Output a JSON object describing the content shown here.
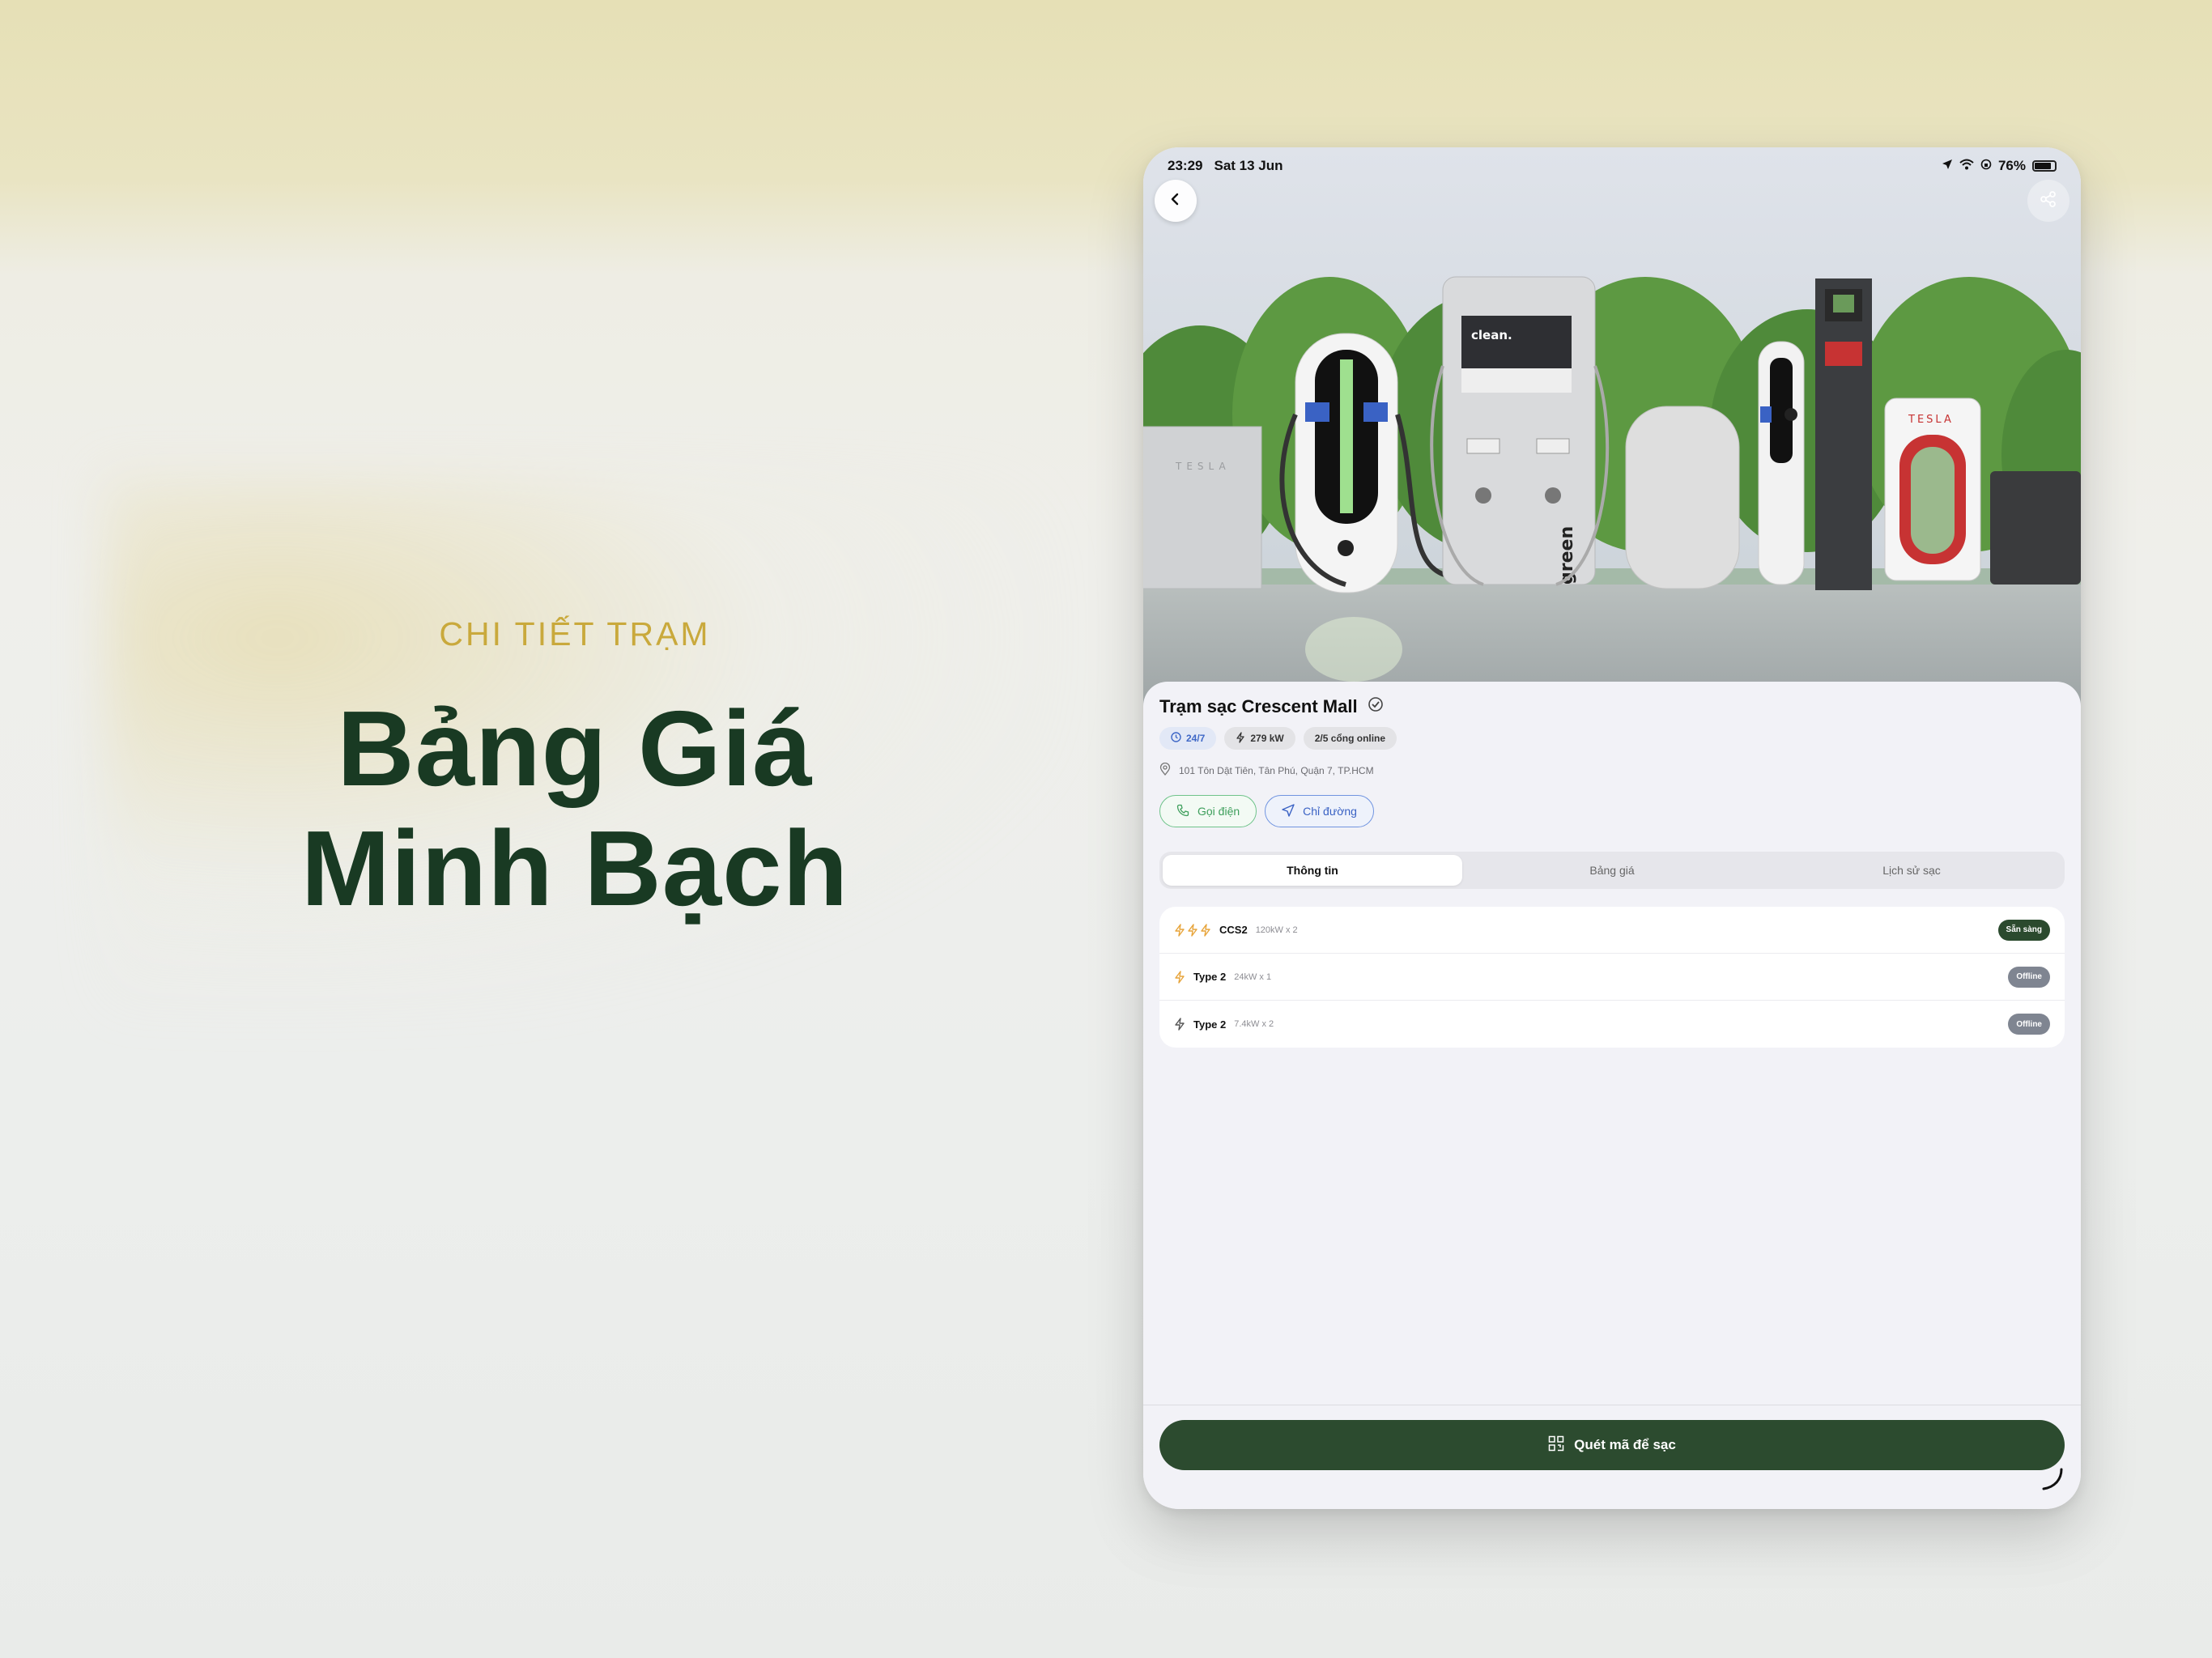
{
  "promo": {
    "eyebrow": "CHI TIẾT TRẠM",
    "title_line1": "Bảng Giá",
    "title_line2": "Minh Bạch"
  },
  "status_bar": {
    "time": "23:29",
    "date": "Sat 13 Jun",
    "battery": "76%"
  },
  "hero": {
    "screen_text": "clean.",
    "brand_text": "TESLA",
    "pillar_text": "green"
  },
  "station": {
    "name": "Trạm sạc Crescent Mall",
    "chips": [
      {
        "label": "24/7",
        "icon": "clock-icon"
      },
      {
        "label": "279 kW",
        "icon": "bolt-icon"
      },
      {
        "label": "2/5 cổng online",
        "icon": ""
      }
    ],
    "address": "101 Tôn Dật Tiên, Tân Phú, Quận 7, TP.HCM",
    "call_label": "Gọi điện",
    "directions_label": "Chỉ đường"
  },
  "tabs": [
    {
      "label": "Thông tin",
      "active": true
    },
    {
      "label": "Bảng giá",
      "active": false
    },
    {
      "label": "Lịch sử sạc",
      "active": false
    }
  ],
  "ports": [
    {
      "name": "CCS2",
      "spec": "120kW x 2",
      "status": "Sẵn sàng",
      "state": "ready",
      "bolt_count": 3
    },
    {
      "name": "Type 2",
      "spec": "24kW x 1",
      "status": "Offline",
      "state": "offline",
      "bolt_count": 1
    },
    {
      "name": "Type 2",
      "spec": "7.4kW x 2",
      "status": "Offline",
      "state": "offline",
      "bolt_count": 1
    }
  ],
  "footer": {
    "scan_label": "Quét mã để sạc"
  },
  "colors": {
    "brand_dark_green": "#2c4b2f",
    "eyebrow_gold": "#c9a93c",
    "title_green": "#193a23",
    "ready_badge": "#2b4a2e",
    "offline_badge": "#7f8591",
    "bolt_orange": "#e7a43a"
  }
}
